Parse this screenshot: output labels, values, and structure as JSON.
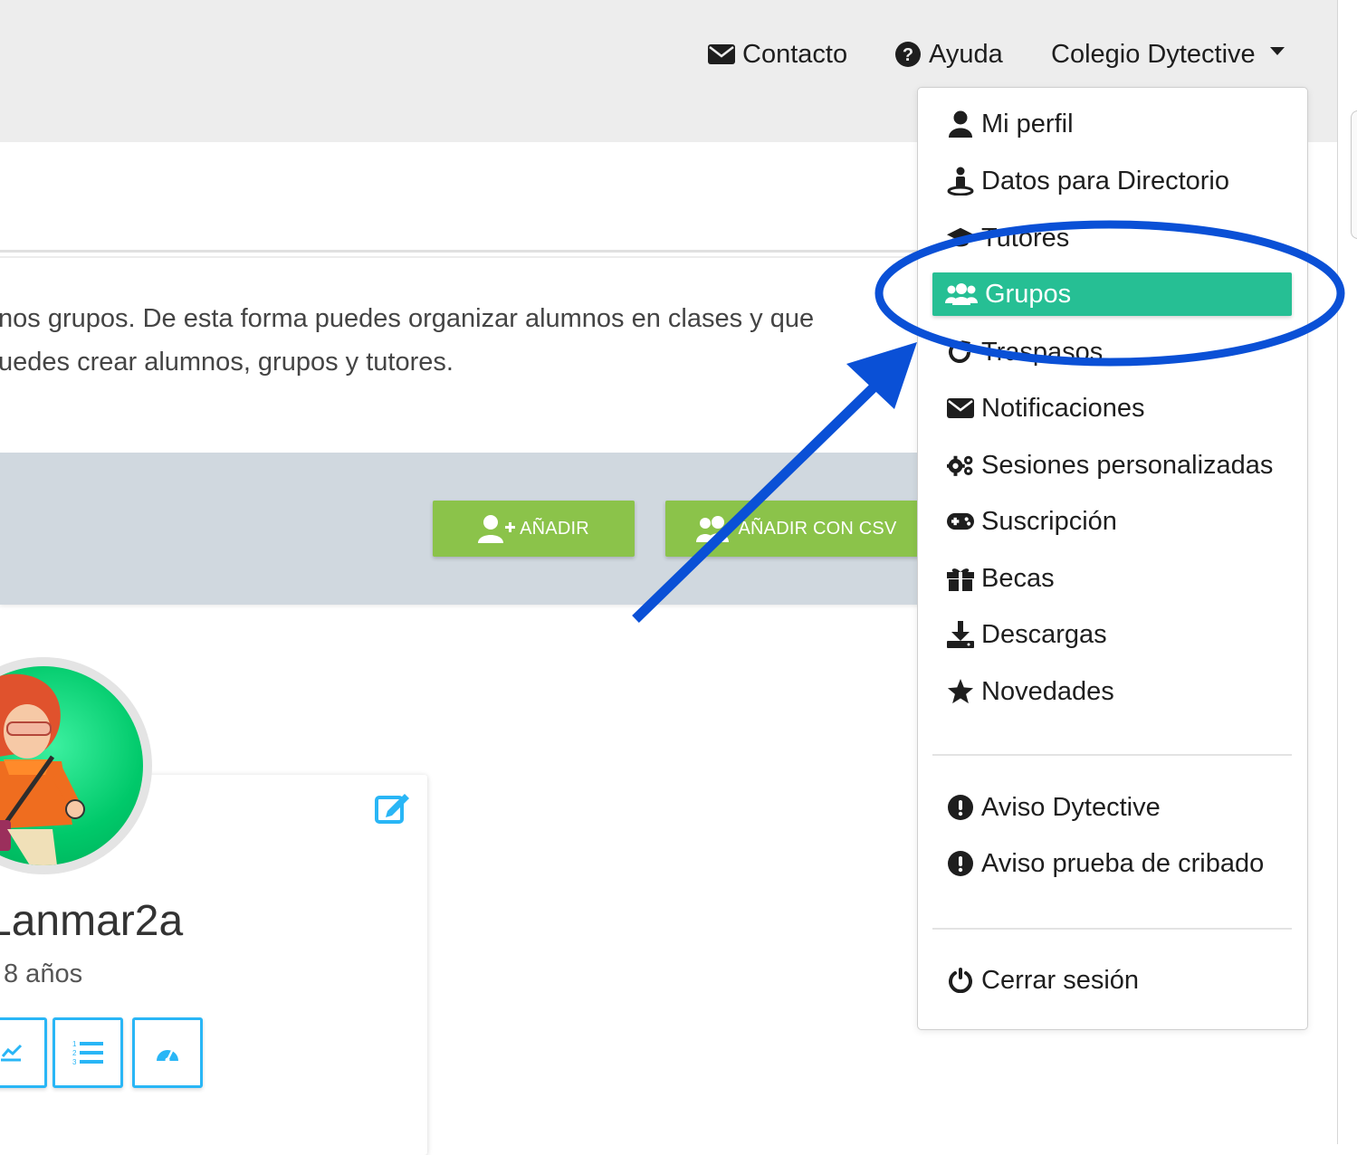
{
  "nav": {
    "contact": "Contacto",
    "help": "Ayuda",
    "account": "Colegio Dytective"
  },
  "intro": {
    "line1": "nos grupos. De esta forma puedes organizar alumnos en clases y que",
    "line2": "uedes crear alumnos, grupos y tutores."
  },
  "actions": {
    "add": "AÑADIR",
    "add_csv": "AÑADIR CON CSV"
  },
  "student": {
    "name": "Lanmar2a",
    "age": "8 años"
  },
  "menu": {
    "items": [
      {
        "label": "Mi perfil",
        "icon": "user-icon"
      },
      {
        "label": "Datos para Directorio",
        "icon": "street-view-icon"
      },
      {
        "label": "Tutores",
        "icon": "graduation-cap-icon"
      },
      {
        "label": "Grupos",
        "icon": "users-icon",
        "active": true
      },
      {
        "label": "Traspasos",
        "icon": "redo-icon"
      },
      {
        "label": "Notificaciones",
        "icon": "envelope-icon"
      },
      {
        "label": "Sesiones personalizadas",
        "icon": "cogs-icon"
      },
      {
        "label": "Suscripción",
        "icon": "gamepad-icon"
      },
      {
        "label": "Becas",
        "icon": "gift-icon"
      },
      {
        "label": "Descargas",
        "icon": "download-icon"
      },
      {
        "label": "Novedades",
        "icon": "star-icon"
      }
    ],
    "alerts": [
      {
        "label": "Aviso Dytective",
        "icon": "exclamation-circle-icon"
      },
      {
        "label": "Aviso prueba de cribado",
        "icon": "exclamation-circle-icon"
      }
    ],
    "logout": {
      "label": "Cerrar sesión",
      "icon": "power-icon"
    }
  },
  "colors": {
    "active_item": "#26bf94",
    "action_button": "#8bc34a",
    "annotation": "#0a50d6",
    "accent_blue": "#29b6f6"
  }
}
